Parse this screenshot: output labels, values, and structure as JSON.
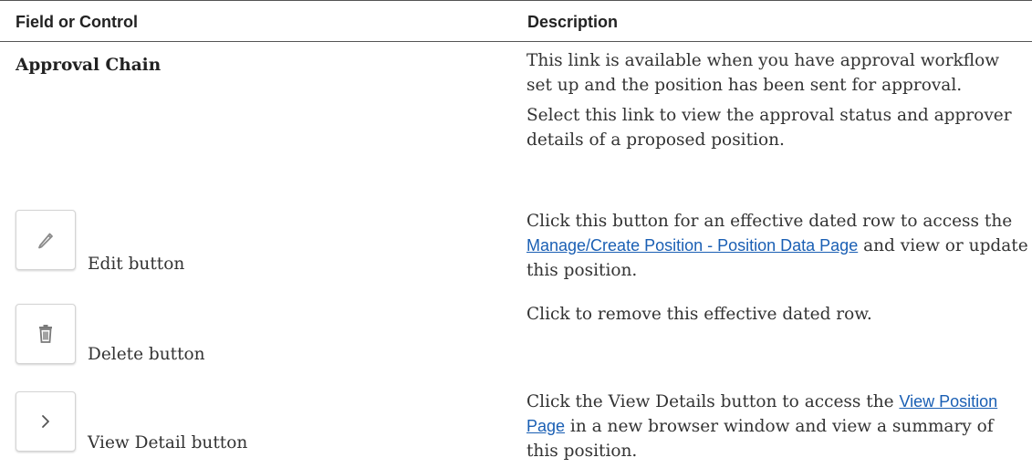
{
  "header": {
    "col1": "Field or Control",
    "col2": "Description"
  },
  "rows": [
    {
      "field": "Approval Chain",
      "desc_p1": "This link is available when you have approval workflow set up and the position has been sent for approval.",
      "desc_p2": "Select this link to view the approval status and approver details of a proposed position."
    },
    {
      "field": "Edit button",
      "icon": "pencil-icon",
      "desc_before": "Click this button for an effective dated row to access the ",
      "desc_link": "Manage/Create Position - Position Data Page",
      "desc_after": " and view or update this position."
    },
    {
      "field": "Delete button",
      "icon": "trash-icon",
      "desc": "Click to remove this effective dated row."
    },
    {
      "field": "View Detail button",
      "icon": "chevron-right-icon",
      "desc_before": "Click the View Details button to access the ",
      "desc_link": "View Position Page",
      "desc_after": " in a new browser window and view a summary of this position."
    }
  ]
}
